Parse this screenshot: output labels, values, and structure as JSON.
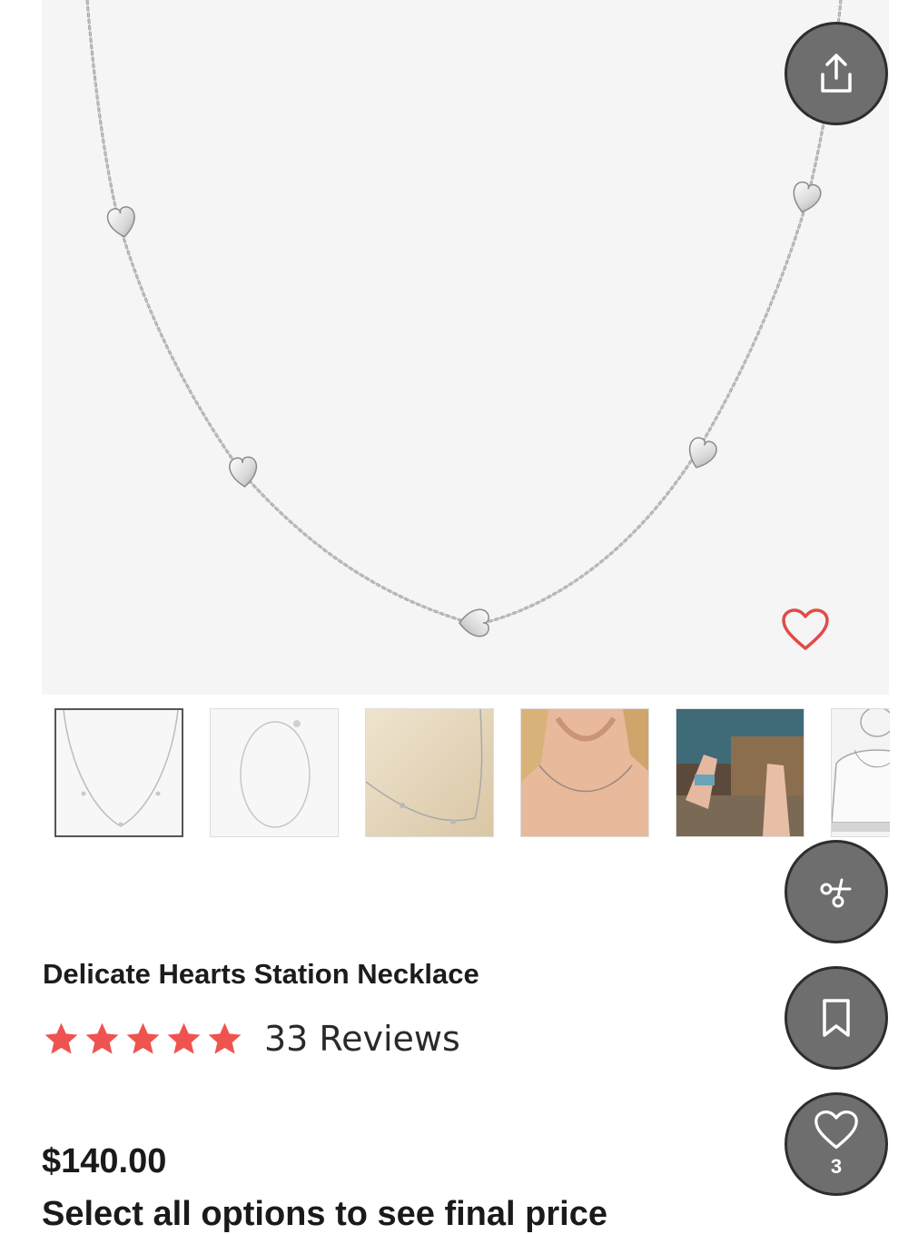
{
  "product": {
    "title": "Delicate Hearts Station Necklace",
    "rating": 5,
    "reviews_label": "33 Reviews",
    "price": "$140.00",
    "note_partial": "Select all options to see final price"
  },
  "actions": {
    "share_icon": "share-upload-icon",
    "cut_icon": "scissors-icon",
    "bookmark_icon": "bookmark-icon",
    "like_icon": "heart-icon",
    "like_count": "3",
    "wishlist_icon": "heart-outline-icon"
  },
  "colors": {
    "star": "#ef5350",
    "wishlist": "#e24a4a",
    "fab_bg": "#6e6e6e",
    "hero_bg": "#f5f5f5"
  },
  "gallery": {
    "thumbnails": [
      {
        "name": "necklace-front",
        "selected": true
      },
      {
        "name": "necklace-full-loop",
        "selected": false
      },
      {
        "name": "necklace-on-beige",
        "selected": false
      },
      {
        "name": "necklace-worn",
        "selected": false
      },
      {
        "name": "necklace-handmade",
        "selected": false
      },
      {
        "name": "necklace-length-guide",
        "selected": false
      }
    ]
  }
}
